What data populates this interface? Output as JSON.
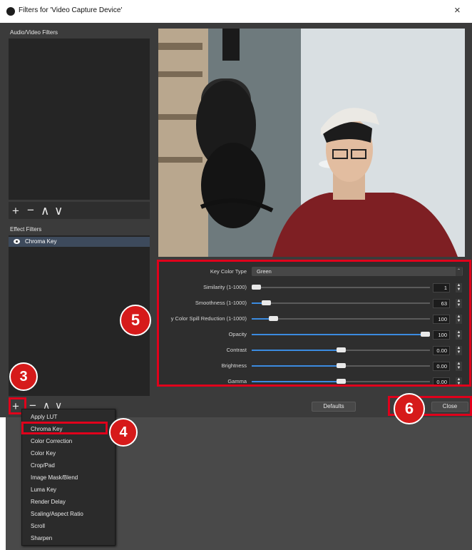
{
  "window": {
    "title": "Filters for 'Video Capture Device'",
    "close": "×"
  },
  "av_filters": {
    "label": "Audio/Video Filters",
    "tools": [
      "+",
      "−",
      "∧",
      "∨"
    ]
  },
  "effect_filters": {
    "label": "Effect Filters",
    "items": [
      {
        "label": "Chroma Key"
      }
    ],
    "tools": [
      "+",
      "−",
      "∧",
      "∨"
    ]
  },
  "properties": {
    "key_color_type": {
      "label": "Key Color Type",
      "value": "Green"
    },
    "sliders": [
      {
        "label": "Similarity (1-1000)",
        "value": "1",
        "fraction": 0.0
      },
      {
        "label": "Smoothness (1-1000)",
        "value": "63",
        "fraction": 0.06
      },
      {
        "label": "y Color Spill Reduction (1-1000)",
        "value": "100",
        "fraction": 0.1
      },
      {
        "label": "Opacity",
        "value": "100",
        "fraction": 1.0
      },
      {
        "label": "Contrast",
        "value": "0.00",
        "fraction": 0.5
      },
      {
        "label": "Brightness",
        "value": "0.00",
        "fraction": 0.5
      },
      {
        "label": "Gamma",
        "value": "0.00",
        "fraction": 0.5
      }
    ]
  },
  "buttons": {
    "defaults": "Defaults",
    "close": "Close"
  },
  "add_menu": {
    "items": [
      "Apply LUT",
      "Chroma Key",
      "Color Correction",
      "Color Key",
      "Crop/Pad",
      "Image Mask/Blend",
      "Luma Key",
      "Render Delay",
      "Scaling/Aspect Ratio",
      "Scroll",
      "Sharpen"
    ]
  },
  "annotations": [
    "3",
    "4",
    "5",
    "6"
  ],
  "colors": {
    "highlight": "#e0001b",
    "slider_fill": "#3b8be0",
    "dialog_bg": "#3b3b3b"
  }
}
